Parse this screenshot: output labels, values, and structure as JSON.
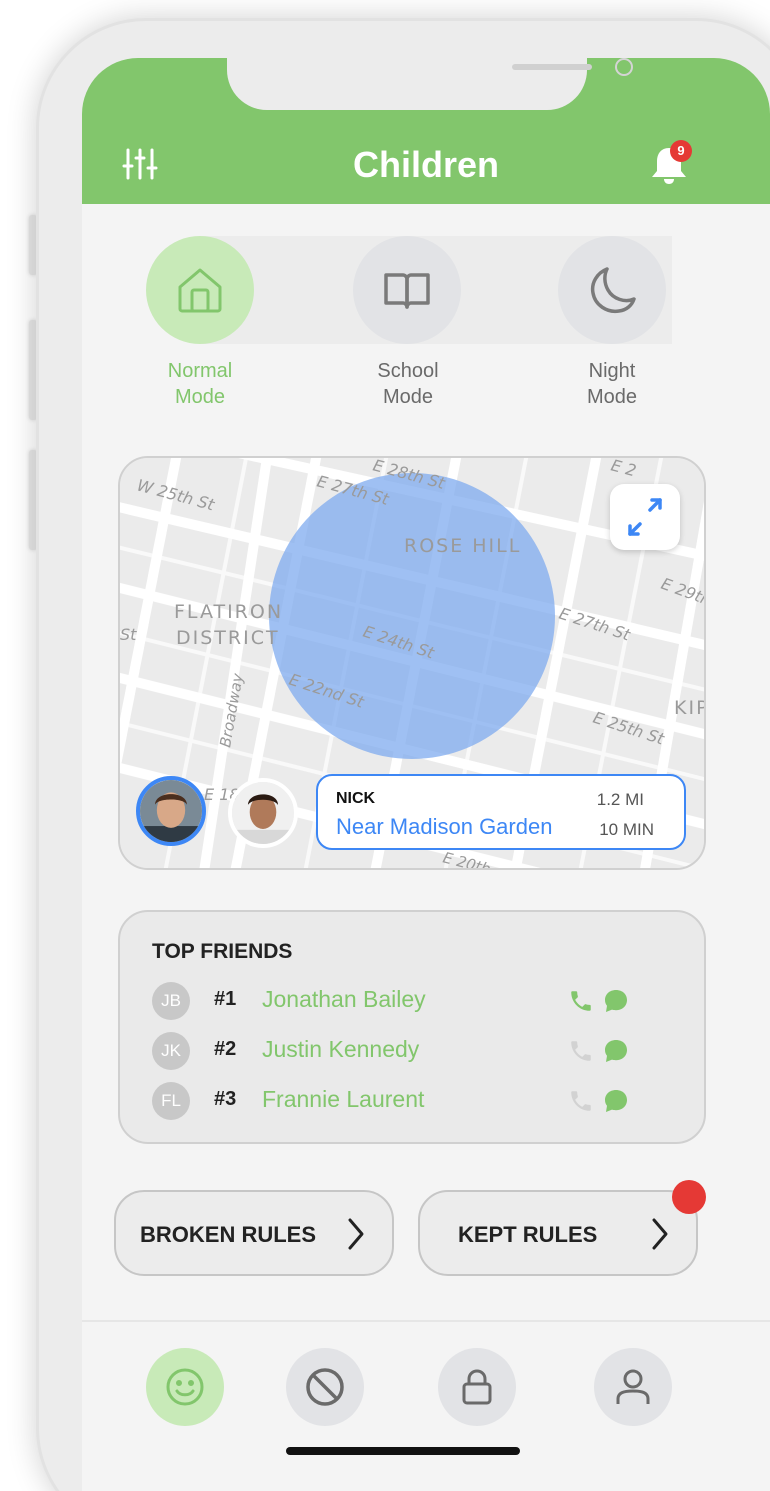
{
  "header": {
    "title": "Children",
    "notification_count": "9",
    "color": "#82c66c"
  },
  "modes": [
    {
      "label": "Normal\nMode",
      "icon": "home-icon",
      "active": true
    },
    {
      "label": "School\nMode",
      "icon": "book-icon",
      "active": false
    },
    {
      "label": "Night\nMode",
      "icon": "moon-icon",
      "active": false
    }
  ],
  "map": {
    "labels": [
      "W 25th St",
      "E 27th St",
      "E 28th St",
      "E 2",
      "ROSE HILL",
      "E 29th",
      "FLATIRON",
      "DISTRICT",
      "E 24th St",
      "E 27th St",
      "Broadway",
      "E 22nd St",
      "KIP",
      "E 25th St",
      "St",
      "E 18",
      "E 20th"
    ],
    "selected_child": {
      "name": "NICK",
      "location": "Near Madison Garden",
      "distance": "1.2 MI",
      "time": "10 MIN"
    }
  },
  "top_friends": {
    "title": "TOP FRIENDS",
    "items": [
      {
        "initials": "JB",
        "rank": "#1",
        "name": "Jonathan Bailey",
        "phone_active": true
      },
      {
        "initials": "JK",
        "rank": "#2",
        "name": "Justin Kennedy",
        "phone_active": false
      },
      {
        "initials": "FL",
        "rank": "#3",
        "name": "Frannie Laurent",
        "phone_active": false
      }
    ]
  },
  "rules": {
    "broken_label": "BROKEN RULES",
    "kept_label": "KEPT RULES"
  },
  "tabs": [
    {
      "icon": "smiley-icon",
      "active": true
    },
    {
      "icon": "block-icon",
      "active": false
    },
    {
      "icon": "lock-icon",
      "active": false
    },
    {
      "icon": "profile-icon",
      "active": false
    }
  ],
  "colors": {
    "accent": "#82c66c",
    "blue": "#3d87f5",
    "alert": "#e53935"
  }
}
